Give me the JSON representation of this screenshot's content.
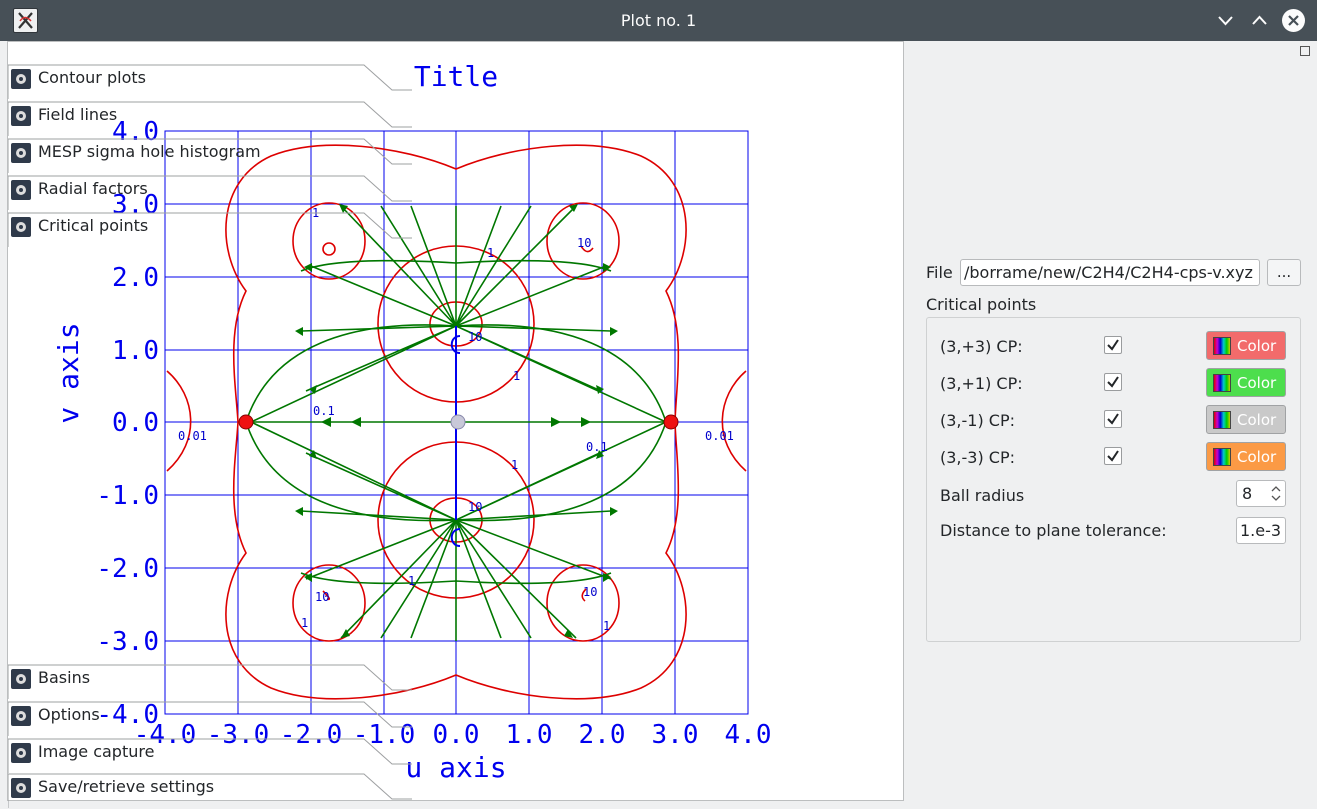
{
  "window": {
    "title": "Plot no. 1"
  },
  "plot": {
    "title": "Title",
    "xlabel": "u axis",
    "ylabel": "v axis",
    "x_ticks": [
      "-4.0",
      "-3.0",
      "-2.0",
      "-1.0",
      "0.0",
      "1.0",
      "2.0",
      "3.0",
      "4.0"
    ],
    "y_ticks": [
      "4.0",
      "3.0",
      "2.0",
      "1.0",
      "0.0",
      "-1.0",
      "-2.0",
      "-3.0",
      "-4.0"
    ],
    "contour_labels": [
      "1",
      "10",
      "1",
      "1",
      "10",
      "0.1",
      "0.01",
      "1",
      "0.1",
      "0.01",
      "1",
      "10",
      "1",
      "10",
      "1",
      "10",
      "1",
      "1"
    ],
    "colors": {
      "axis": "#0000ee",
      "contour": "#dd0000",
      "field_lines": "#007700",
      "cp_nuclear": "#ee1111",
      "cp_ring": "#c8c8d8"
    }
  },
  "panel": {
    "tabs_top": [
      "Contour plots",
      "Field lines",
      "MESP sigma hole histogram",
      "Radial factors",
      "Critical points"
    ],
    "file_label": "File",
    "file_value": "/borrame/new/C2H4/C2H4-cps-v.xyz",
    "browse_label": "...",
    "group_title": "Critical points",
    "cp_rows": [
      {
        "label": "(3,+3) CP:",
        "checked": true,
        "color_label": "Color",
        "color": "#f26b6b"
      },
      {
        "label": "(3,+1) CP:",
        "checked": true,
        "color_label": "Color",
        "color": "#4dde4d"
      },
      {
        "label": "(3,-1) CP:",
        "checked": true,
        "color_label": "Color",
        "color": "#c9c9c9"
      },
      {
        "label": "(3,-3) CP:",
        "checked": true,
        "color_label": "Color",
        "color": "#fb9a45"
      }
    ],
    "ball_radius_label": "Ball radius",
    "ball_radius_value": "8",
    "tolerance_label": "Distance to plane tolerance:",
    "tolerance_value": "1.e-3",
    "tabs_bottom": [
      "Basins",
      "Options",
      "Image capture",
      "Save/retrieve settings"
    ]
  }
}
